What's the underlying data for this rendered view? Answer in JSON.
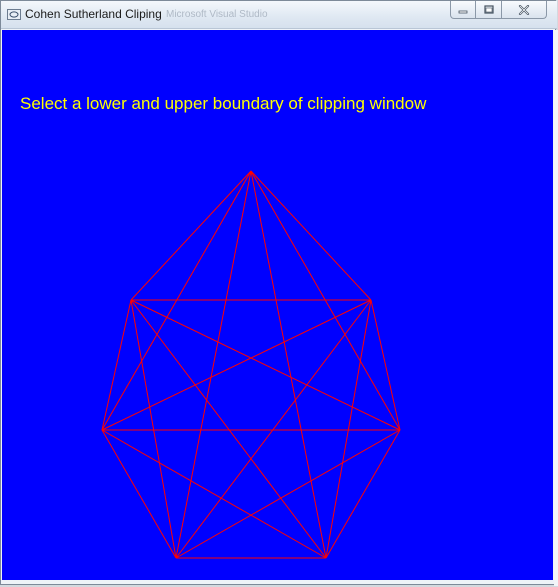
{
  "window": {
    "title": "Cohen Sutherland Cliping",
    "background_title": "Microsoft Visual Studio",
    "controls": {
      "minimize_icon": "minimize-icon",
      "maximize_icon": "maximize-icon",
      "close_icon": "close-icon"
    }
  },
  "canvas": {
    "background_color": "#0000ff",
    "instruction_text": "Select a lower and upper boundary of clipping window",
    "instruction_color": "#ffff00",
    "line_color": "#ff0000",
    "figure": "complete graph on 7 vertices (heptagon with all diagonals)"
  }
}
